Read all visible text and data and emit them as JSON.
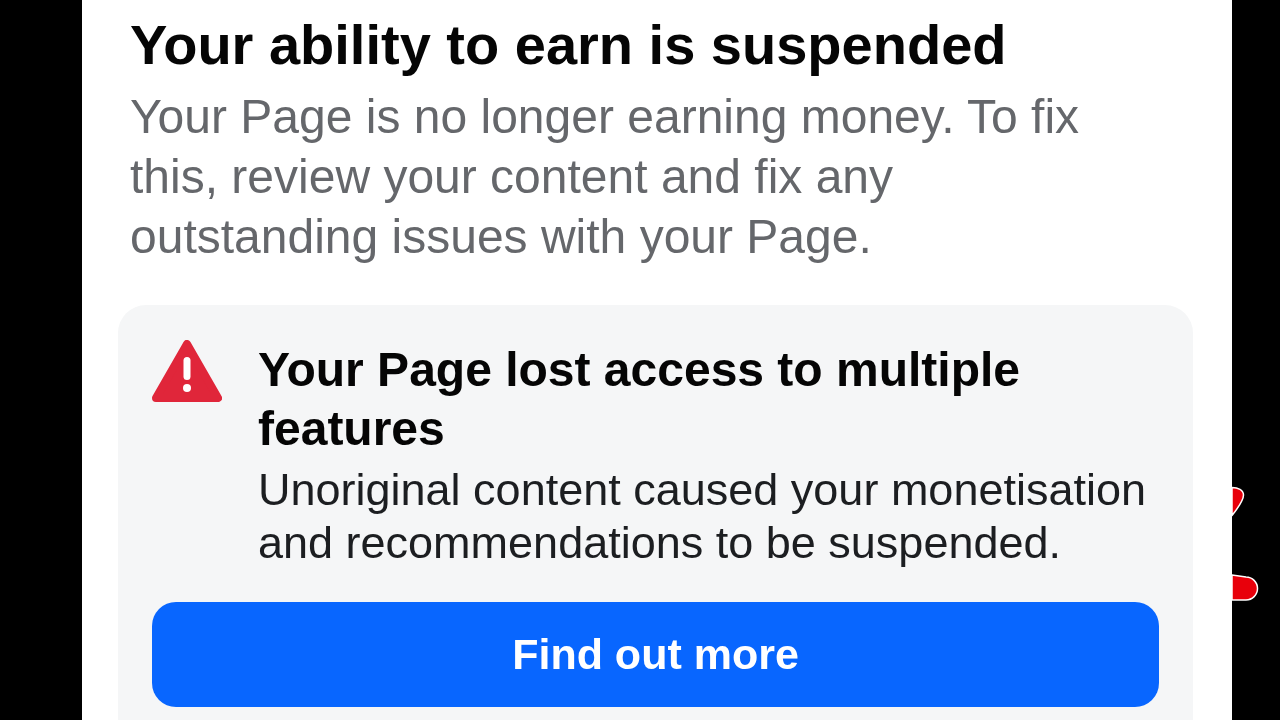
{
  "heading": {
    "title": "Your ability to earn is suspended",
    "description": "Your Page is no longer earning money. To fix this, review your content and fix any outstanding issues with your Page."
  },
  "alert_card": {
    "title": "Your Page lost access to multiple features",
    "message": "Unoriginal content caused your monetisation and recommendations to be suspended.",
    "button": "Find out more"
  }
}
